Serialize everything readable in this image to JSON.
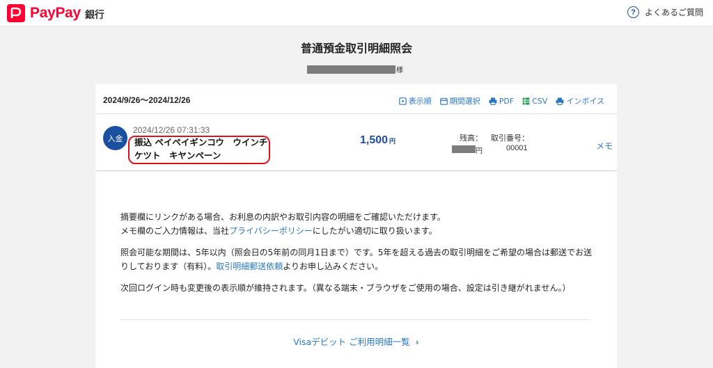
{
  "header": {
    "logo_text": "PayPay",
    "logo_sub": "銀行",
    "faq_label": "よくあるご質問"
  },
  "page": {
    "title": "普通預金取引明細照会",
    "name_suffix": "様"
  },
  "toolbar": {
    "period": "2024/9/26〜2024/12/26",
    "items": [
      {
        "label": "表示順",
        "icon": "sort-icon"
      },
      {
        "label": "期間選択",
        "icon": "calendar-icon"
      },
      {
        "label": "PDF",
        "icon": "printer-icon"
      },
      {
        "label": "CSV",
        "icon": "spreadsheet-icon"
      },
      {
        "label": "インボイス",
        "icon": "printer-icon"
      }
    ]
  },
  "transaction": {
    "type": "入金",
    "datetime": "2024/12/26 07:31:33",
    "description_line1": "振込 ペイペイギンコウ　ウインチ",
    "description_line2": "ケツト　キヤンペーン",
    "amount": "1,500",
    "amount_unit": "円",
    "balance_label": "残高：",
    "balance_unit": "円",
    "txno_label": "取引番号：",
    "txno_value": "00001",
    "memo_label": "メモ"
  },
  "notes": {
    "p1_line1": "摘要欄にリンクがある場合、お利息の内訳やお取引内容の明細をご確認いただけます。",
    "p1_line2_pre": "メモ欄のご入力情報は、当社",
    "p1_link": "プライバシーポリシー",
    "p1_line2_post": "にしたがい適切に取り扱います。",
    "p2_pre": "照会可能な期間は、5年以内（照会日の5年前の同月1日まで）です。5年を超える過去の取引明細をご希望の場合は郵送でお送りしております（有料）。",
    "p2_link": "取引明細郵送依頼",
    "p2_post": "よりお申し込みください。",
    "p3": "次回ログイン時も変更後の表示順が維持されます。（異なる端末・ブラウザをご使用の場合、設定は引き継がれません。）"
  },
  "footer": {
    "visa_link": "Visaデビット ご利用明細一覧"
  },
  "colors": {
    "brand_red": "#ff0033",
    "navy": "#1b4fa0",
    "link_blue": "#2a78c4",
    "highlight_red": "#e0101a"
  }
}
